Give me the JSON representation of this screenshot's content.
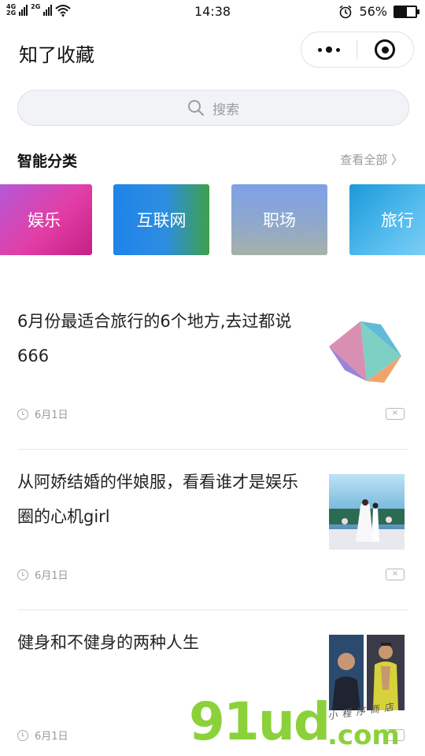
{
  "status_bar": {
    "network_top": "4G",
    "network_bottom": "2G",
    "network_second": "2G",
    "time": "14:38",
    "battery": "56%",
    "battery_level": 0.56
  },
  "header": {
    "title": "知了收藏"
  },
  "search": {
    "placeholder": "搜索"
  },
  "categories_section": {
    "title": "智能分类",
    "see_all": "查看全部 〉",
    "items": [
      {
        "label": "娱乐"
      },
      {
        "label": "互联网"
      },
      {
        "label": "职场"
      },
      {
        "label": "旅行"
      }
    ]
  },
  "articles": [
    {
      "title": "6月份最适合旅行的6个地方,去过都说666",
      "date": "6月1日",
      "dismiss": "×"
    },
    {
      "title": "从阿娇结婚的伴娘服，看看谁才是娱乐圈的心机girl",
      "date": "6月1日",
      "dismiss": "×"
    },
    {
      "title": "健身和不健身的两种人生",
      "date": "6月1日",
      "dismiss": "×"
    }
  ],
  "watermark": {
    "main": "91ud",
    "suffix": ".com",
    "script": "小程序商店"
  }
}
